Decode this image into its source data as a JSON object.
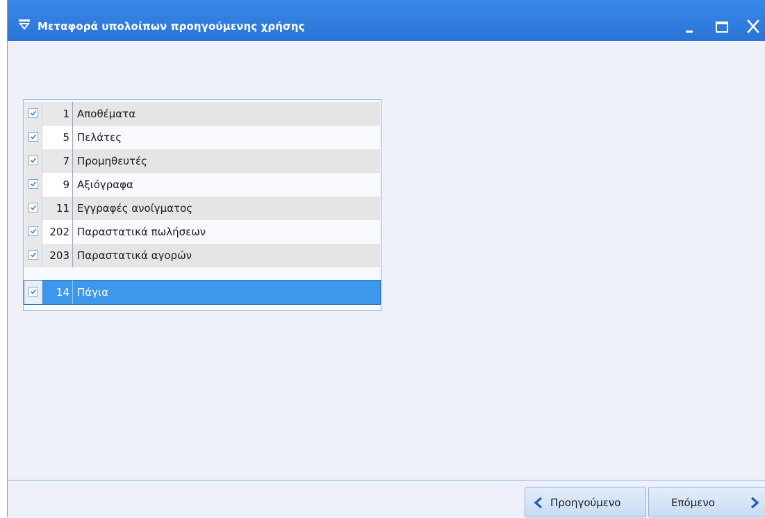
{
  "window": {
    "title": "Μεταφορά υπολοίπων προηγούμενης χρήσης",
    "controls": {
      "minimize": "_",
      "maximize": "□",
      "close": "X"
    }
  },
  "list": {
    "rows": [
      {
        "checked": true,
        "number": "1",
        "label": "Αποθέματα"
      },
      {
        "checked": true,
        "number": "5",
        "label": "Πελάτες"
      },
      {
        "checked": true,
        "number": "7",
        "label": "Προμηθευτές"
      },
      {
        "checked": true,
        "number": "9",
        "label": "Αξιόγραφα"
      },
      {
        "checked": true,
        "number": "11",
        "label": "Εγγραφές ανοίγματος"
      },
      {
        "checked": true,
        "number": "202",
        "label": "Παραστατικά πωλήσεων"
      },
      {
        "checked": true,
        "number": "203",
        "label": "Παραστατικά αγορών"
      },
      {
        "checked": true,
        "number": "14",
        "label": "Πάγια",
        "selected": true
      }
    ]
  },
  "footer": {
    "prev_label": "Προηγούμενο",
    "next_label": "Επόμενο"
  },
  "colors": {
    "titlebar": "#2f7fe0",
    "selection": "#3d97ea",
    "background": "#eef0fa"
  }
}
